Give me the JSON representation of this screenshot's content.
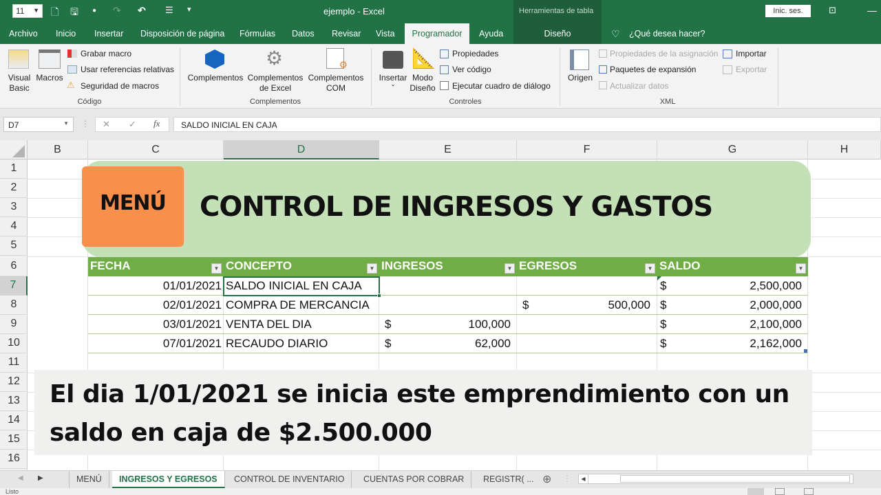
{
  "titlebar": {
    "font_size": "11",
    "window_title": "ejemplo  -  Excel",
    "table_tools": "Herramientas de tabla",
    "sign_in": "Inic. ses."
  },
  "ribbon_tabs": [
    "Archivo",
    "Inicio",
    "Insertar",
    "Disposición de página",
    "Fórmulas",
    "Datos",
    "Revisar",
    "Vista",
    "Programador",
    "Ayuda",
    "Diseño"
  ],
  "active_tab": "Programador",
  "tell_me": "¿Qué desea hacer?",
  "ribbon": {
    "codigo": {
      "label": "Código",
      "visual_basic": "Visual Basic",
      "macros": "Macros",
      "grabar_macro": "Grabar macro",
      "usar_referencias": "Usar referencias relativas",
      "seguridad": "Seguridad de macros"
    },
    "complementos": {
      "label": "Complementos",
      "complementos": "Complementos",
      "excel_1": "Complementos",
      "excel_2": "de Excel",
      "com_1": "Complementos",
      "com_2": "COM"
    },
    "controles": {
      "label": "Controles",
      "insertar": "Insertar",
      "modo_1": "Modo",
      "modo_2": "Diseño",
      "propiedades": "Propiedades",
      "ver_codigo": "Ver código",
      "ejecutar": "Ejecutar cuadro de diálogo"
    },
    "xml": {
      "label": "XML",
      "origen": "Origen",
      "prop_asignacion": "Propiedades de la asignación",
      "paquetes": "Paquetes de expansión",
      "actualizar": "Actualizar datos",
      "importar": "Importar",
      "exportar": "Exportar"
    }
  },
  "formula_bar": {
    "name_box": "D7",
    "formula": "SALDO INICIAL EN CAJA"
  },
  "columns": [
    "B",
    "C",
    "D",
    "E",
    "F",
    "G",
    "H"
  ],
  "selected_column": "D",
  "rows": [
    "1",
    "2",
    "3",
    "4",
    "5",
    "6",
    "7",
    "8",
    "9",
    "10",
    "11",
    "12",
    "13",
    "14",
    "15",
    "16"
  ],
  "selected_row": "7",
  "banner": {
    "menu_button": "MENÚ",
    "title": "CONTROL DE INGRESOS Y GASTOS"
  },
  "table": {
    "headers": [
      "FECHA",
      "CONCEPTO",
      "INGRESOS",
      "EGRESOS",
      "SALDO"
    ],
    "currency": "$",
    "rows": [
      {
        "fecha": "01/01/2021",
        "concepto": "SALDO INICIAL EN CAJA",
        "ingresos": "",
        "egresos": "",
        "saldo": "2,500,000"
      },
      {
        "fecha": "02/01/2021",
        "concepto": "COMPRA DE MERCANCIA",
        "ingresos": "",
        "egresos": "500,000",
        "saldo": "2,000,000"
      },
      {
        "fecha": "03/01/2021",
        "concepto": "VENTA DEL DIA",
        "ingresos": "100,000",
        "egresos": "",
        "saldo": "2,100,000"
      },
      {
        "fecha": "07/01/2021",
        "concepto": "RECAUDO DIARIO",
        "ingresos": "62,000",
        "egresos": "",
        "saldo": "2,162,000"
      }
    ]
  },
  "note": "El dia 1/01/2021  se inicia este emprendimiento con un saldo en caja de $2.500.000",
  "sheets": [
    "MENÚ",
    "INGRESOS Y EGRESOS",
    "CONTROL DE INVENTARIO",
    "CUENTAS POR COBRAR",
    "REGISTR( ..."
  ],
  "active_sheet": "INGRESOS Y EGRESOS",
  "status": "Listo",
  "colors": {
    "excel_green": "#217346",
    "table_header": "#70ad47",
    "banner": "#c3e0b6",
    "menu_button": "#f88f4b"
  }
}
